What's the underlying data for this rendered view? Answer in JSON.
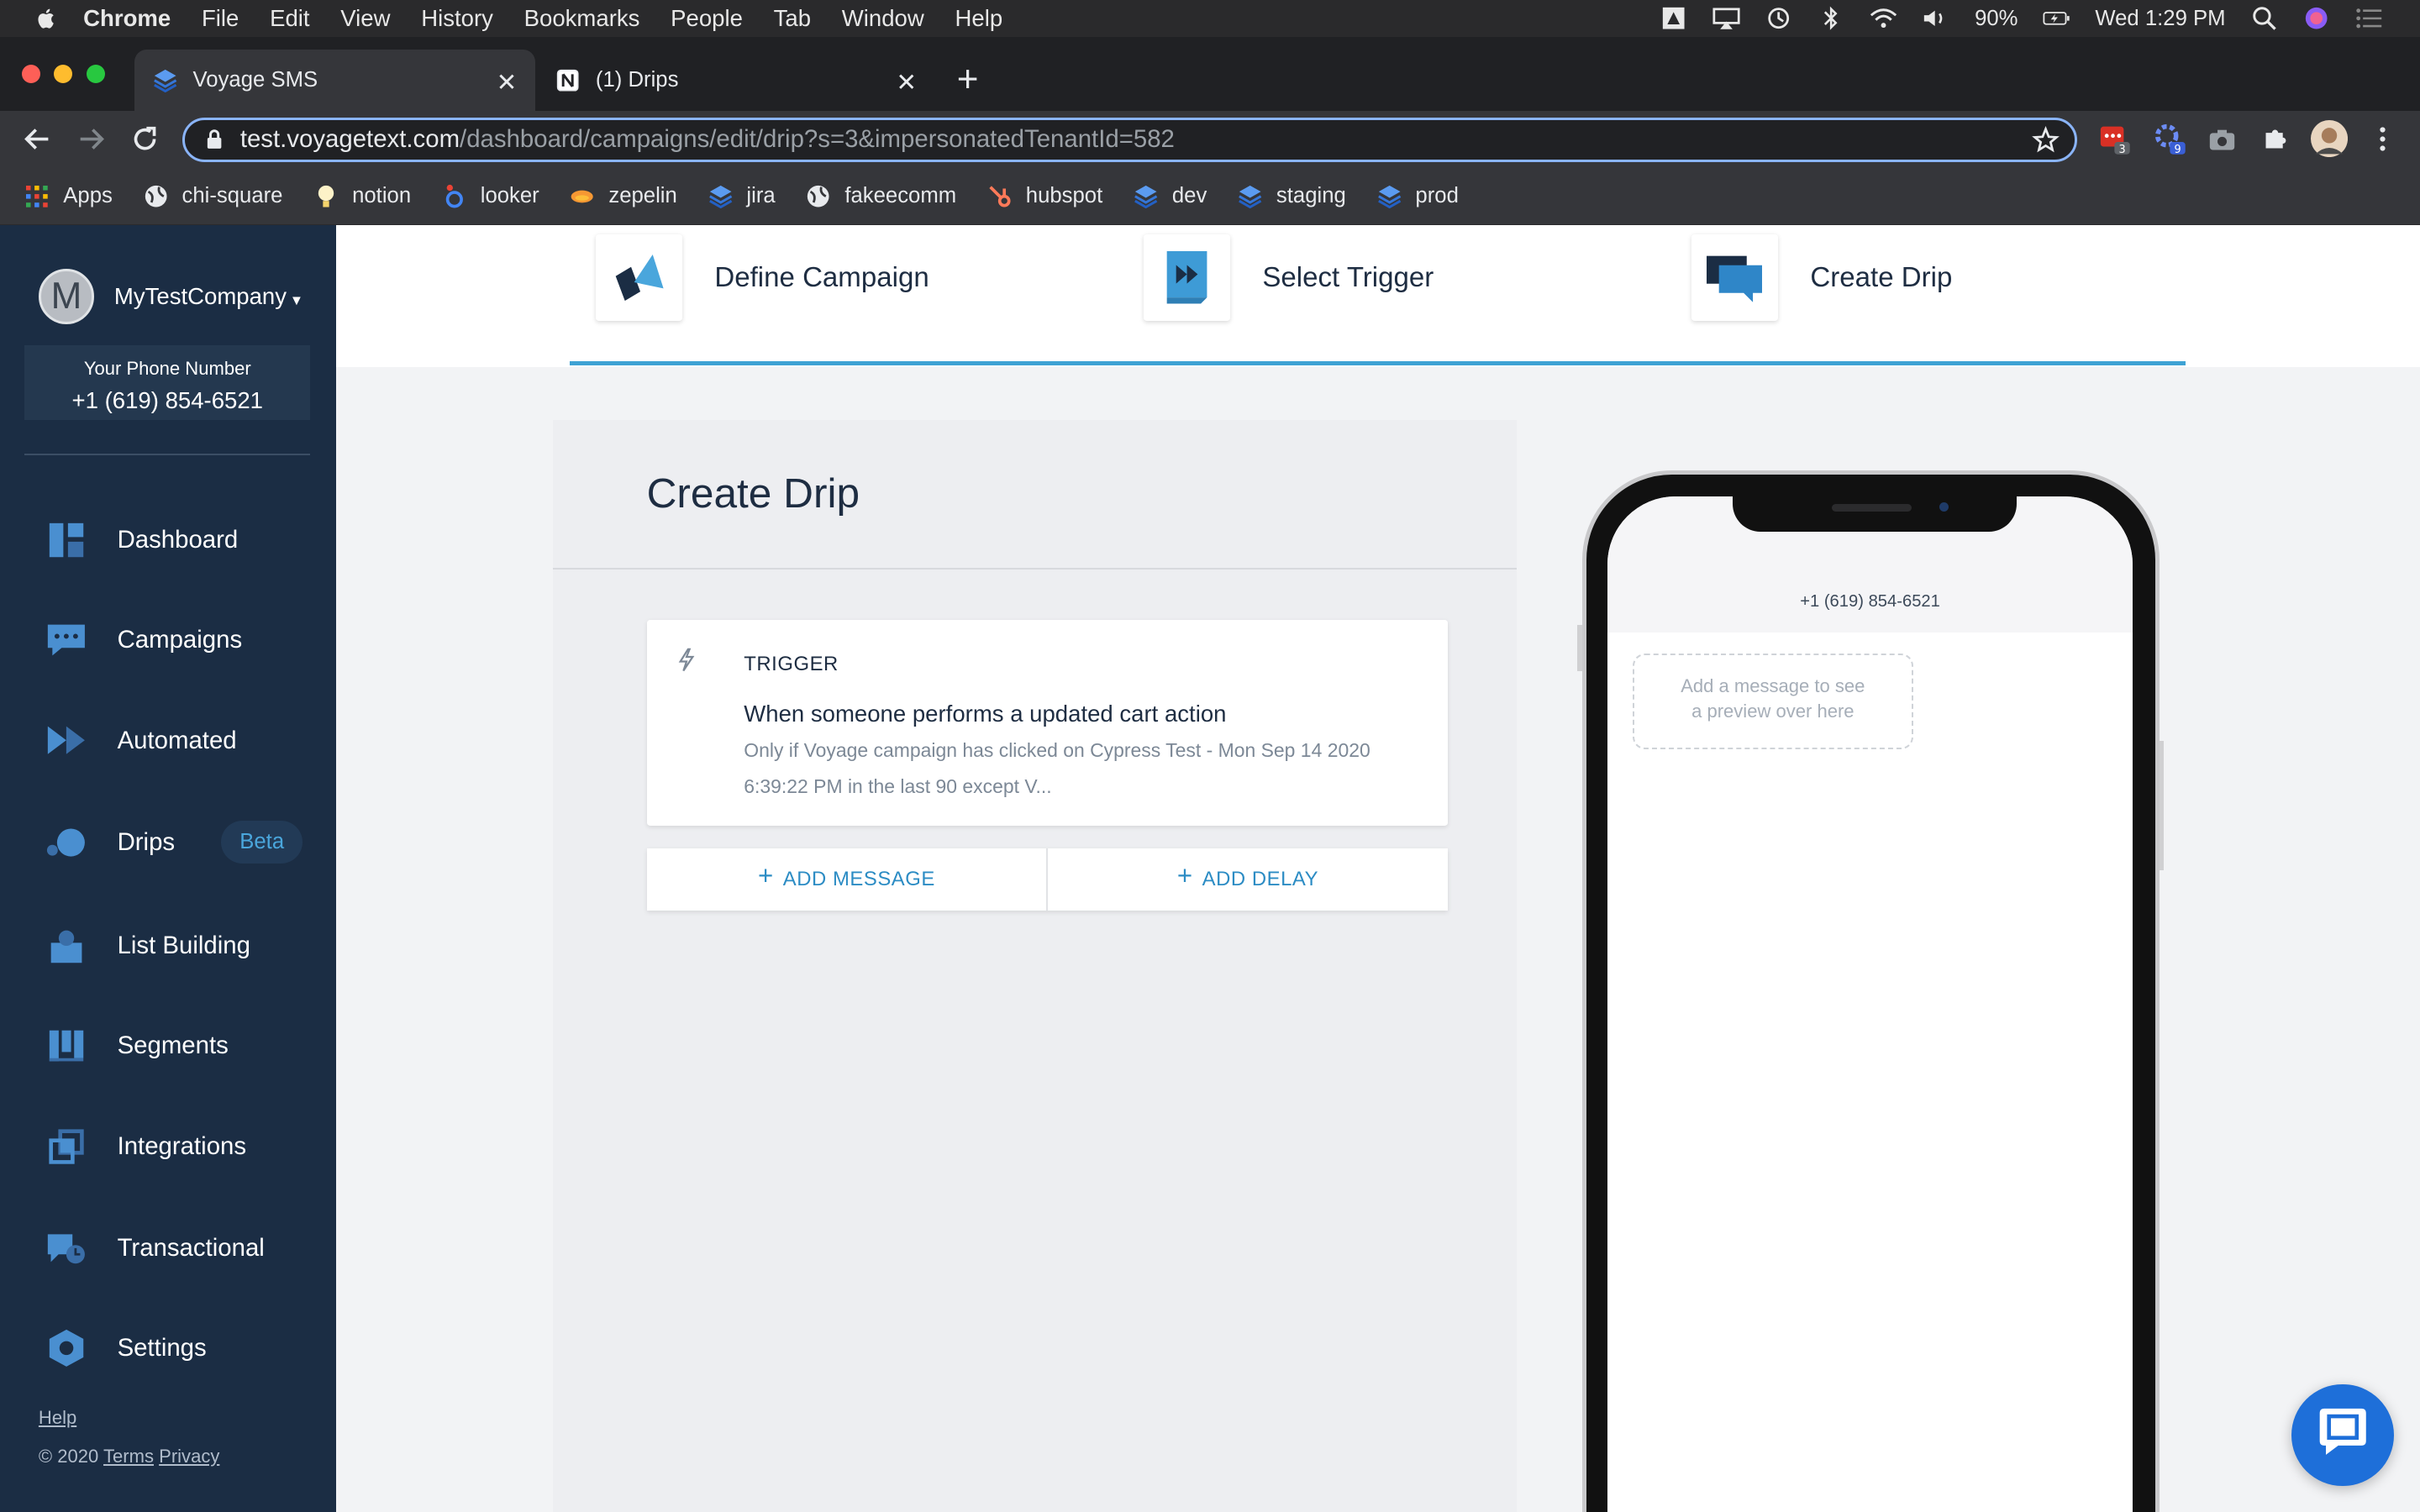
{
  "menubar": {
    "app": "Chrome",
    "items": [
      "File",
      "Edit",
      "View",
      "History",
      "Bookmarks",
      "People",
      "Tab",
      "Window",
      "Help"
    ],
    "battery": "90%",
    "clock": "Wed 1:29 PM"
  },
  "tabs": [
    {
      "title": "Voyage SMS",
      "active": true
    },
    {
      "title": "(1) Drips",
      "active": false
    }
  ],
  "address": {
    "host": "test.voyagetext.com",
    "path": "/dashboard/campaigns/edit/drip?s=3&impersonatedTenantId=582"
  },
  "extensions": {
    "badge1": "3",
    "badge2": "9"
  },
  "bookmarks": [
    "Apps",
    "chi-square",
    "notion",
    "looker",
    "zepelin",
    "jira",
    "fakeecomm",
    "hubspot",
    "dev",
    "staging",
    "prod"
  ],
  "sidebar": {
    "company_initial": "M",
    "company_name": "MyTestCompany",
    "phone_label": "Your Phone Number",
    "phone_number": "+1 (619) 854-6521",
    "nav": [
      {
        "label": "Dashboard",
        "icon": "dashboard-icon"
      },
      {
        "label": "Campaigns",
        "icon": "chat-icon"
      },
      {
        "label": "Automated",
        "icon": "fast-forward-icon"
      },
      {
        "label": "Drips",
        "icon": "drips-icon",
        "badge": "Beta"
      },
      {
        "label": "List Building",
        "icon": "list-building-icon"
      },
      {
        "label": "Segments",
        "icon": "segments-icon"
      },
      {
        "label": "Integrations",
        "icon": "integrations-icon"
      },
      {
        "label": "Transactional",
        "icon": "transactional-icon"
      },
      {
        "label": "Settings",
        "icon": "settings-icon"
      }
    ],
    "help": "Help",
    "copyright": "© 2020",
    "terms": "Terms",
    "privacy": "Privacy"
  },
  "steps": [
    {
      "label": "Define Campaign"
    },
    {
      "label": "Select Trigger"
    },
    {
      "label": "Create Drip"
    }
  ],
  "panel": {
    "title": "Create Drip",
    "trigger_label": "TRIGGER",
    "trigger_title": "When someone performs a updated cart action",
    "trigger_desc": "Only if Voyage campaign has clicked on Cypress Test - Mon Sep 14 2020 6:39:22 PM in the last 90 except V...",
    "add_message": "ADD MESSAGE",
    "add_delay": "ADD DELAY"
  },
  "preview": {
    "phone_number": "+1 (619) 854-6521",
    "placeholder_line1": "Add a message to see",
    "placeholder_line2": "a preview over here"
  },
  "colors": {
    "sidebar": "#1b2d44",
    "accent": "#3ea2d4",
    "link": "#2c8cc4",
    "chat_fab": "#1e6fd9"
  }
}
